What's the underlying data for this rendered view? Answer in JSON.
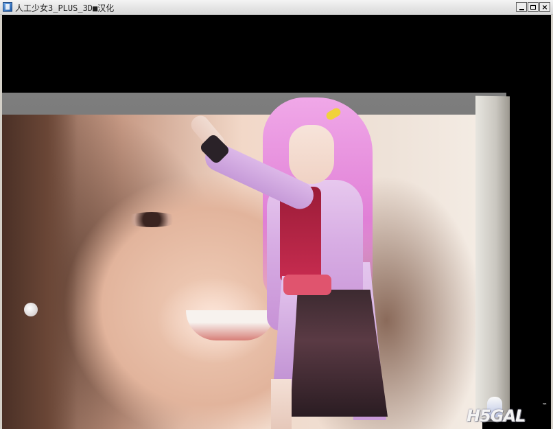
{
  "window": {
    "title": "人工少女3_PLUS_3D■汉化",
    "app_icon": "app-icon",
    "buttons": {
      "minimize": "minimize-icon",
      "maximize": "maximize-icon",
      "close": "close-icon",
      "close_glyph": "×"
    }
  },
  "scene": {
    "description_icons": [
      "monitor",
      "photo",
      "character"
    ]
  },
  "watermark": {
    "logo_text": "H5GAL",
    "trademark": "™"
  },
  "colors": {
    "titlebar": "#e6e6e6",
    "viewport_bg": "#000000",
    "character_hair": "#e890dc",
    "character_coat": "#d8aee4",
    "character_accent": "#c82c50"
  }
}
